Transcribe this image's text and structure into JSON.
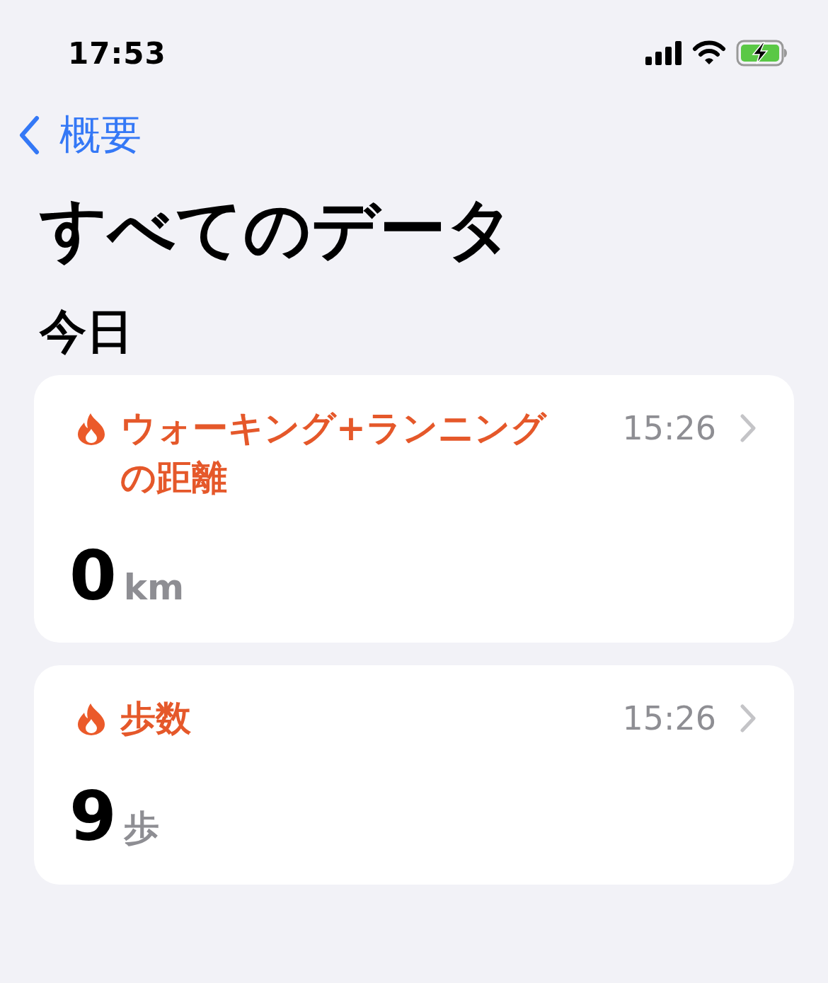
{
  "status_bar": {
    "time": "17:53"
  },
  "nav": {
    "back_label": "概要"
  },
  "title": "すべてのデータ",
  "section_header": "今日",
  "cards": [
    {
      "title": "ウォーキング+ランニングの距離",
      "time": "15:26",
      "value": "0",
      "unit": "km"
    },
    {
      "title": "歩数",
      "time": "15:26",
      "value": "9",
      "unit": "歩"
    }
  ]
}
